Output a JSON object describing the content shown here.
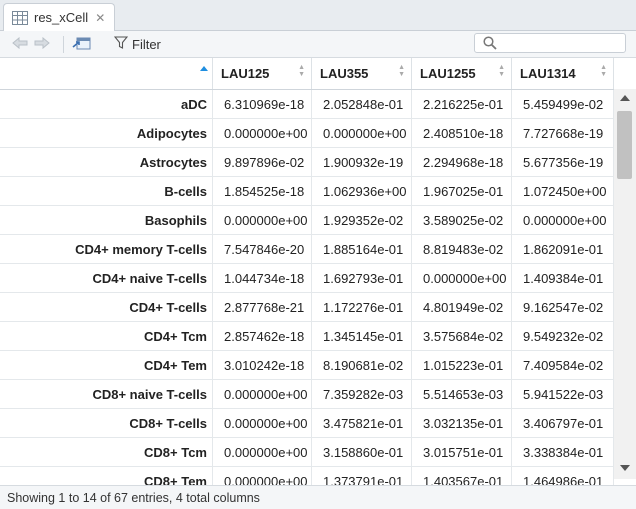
{
  "tab": {
    "label": "res_xCell",
    "close": "✕"
  },
  "toolbar": {
    "filter_label": "Filter",
    "search_placeholder": ""
  },
  "columns": [
    "",
    "LAU125",
    "LAU355",
    "LAU1255",
    "LAU1314"
  ],
  "rows": [
    {
      "name": "aDC",
      "values": [
        "6.310969e-18",
        "2.052848e-01",
        "2.216225e-01",
        "5.459499e-02"
      ]
    },
    {
      "name": "Adipocytes",
      "values": [
        "0.000000e+00",
        "0.000000e+00",
        "2.408510e-18",
        "7.727668e-19"
      ]
    },
    {
      "name": "Astrocytes",
      "values": [
        "9.897896e-02",
        "1.900932e-19",
        "2.294968e-18",
        "5.677356e-19"
      ]
    },
    {
      "name": "B-cells",
      "values": [
        "1.854525e-18",
        "1.062936e+00",
        "1.967025e-01",
        "1.072450e+00"
      ]
    },
    {
      "name": "Basophils",
      "values": [
        "0.000000e+00",
        "1.929352e-02",
        "3.589025e-02",
        "0.000000e+00"
      ]
    },
    {
      "name": "CD4+ memory T-cells",
      "values": [
        "7.547846e-20",
        "1.885164e-01",
        "8.819483e-02",
        "1.862091e-01"
      ]
    },
    {
      "name": "CD4+ naive T-cells",
      "values": [
        "1.044734e-18",
        "1.692793e-01",
        "0.000000e+00",
        "1.409384e-01"
      ]
    },
    {
      "name": "CD4+ T-cells",
      "values": [
        "2.877768e-21",
        "1.172276e-01",
        "4.801949e-02",
        "9.162547e-02"
      ]
    },
    {
      "name": "CD4+ Tcm",
      "values": [
        "2.857462e-18",
        "1.345145e-01",
        "3.575684e-02",
        "9.549232e-02"
      ]
    },
    {
      "name": "CD4+ Tem",
      "values": [
        "3.010242e-18",
        "8.190681e-02",
        "1.015223e-01",
        "7.409584e-02"
      ]
    },
    {
      "name": "CD8+ naive T-cells",
      "values": [
        "0.000000e+00",
        "7.359282e-03",
        "5.514653e-03",
        "5.941522e-03"
      ]
    },
    {
      "name": "CD8+ T-cells",
      "values": [
        "0.000000e+00",
        "3.475821e-01",
        "3.032135e-01",
        "3.406797e-01"
      ]
    },
    {
      "name": "CD8+ Tcm",
      "values": [
        "0.000000e+00",
        "3.158860e-01",
        "3.015751e-01",
        "3.338384e-01"
      ]
    },
    {
      "name": "CD8+ Tem",
      "values": [
        "0.000000e+00",
        "1.373791e-01",
        "1.403567e-01",
        "1.464986e-01"
      ]
    }
  ],
  "footer": {
    "status": "Showing 1 to 14 of 67 entries, 4 total columns"
  }
}
